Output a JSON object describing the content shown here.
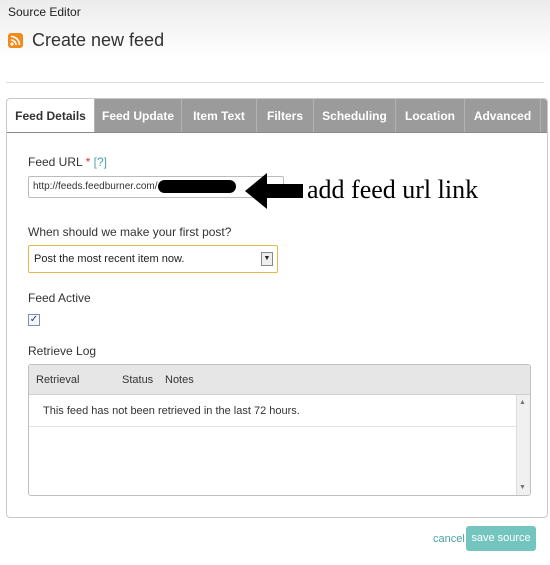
{
  "window_title": "Source Editor",
  "page_title": "Create new feed",
  "icon_rss": "rss-icon",
  "tabs": [
    {
      "label": "Feed Details",
      "active": true
    },
    {
      "label": "Feed Update",
      "active": false
    },
    {
      "label": "Item Text",
      "active": false
    },
    {
      "label": "Filters",
      "active": false
    },
    {
      "label": "Scheduling",
      "active": false
    },
    {
      "label": "Location",
      "active": false
    },
    {
      "label": "Advanced",
      "active": false
    }
  ],
  "feed_url": {
    "label": "Feed URL",
    "required_marker": "*",
    "help": "[?]",
    "value": "http://feeds.feedburner.com/"
  },
  "annotation": {
    "text": "add feed url link"
  },
  "first_post": {
    "label": "When should we make your first post?",
    "selected": "Post the most recent item now."
  },
  "feed_active": {
    "label": "Feed Active",
    "checked": true
  },
  "retrieve_log": {
    "label": "Retrieve Log",
    "columns": [
      "Retrieval",
      "Status",
      "Notes"
    ],
    "empty_message": "This feed has not been retrieved in the last 72 hours."
  },
  "actions": {
    "cancel": "cancel",
    "save": "save source"
  },
  "colors": {
    "accent": "#4aa3a0",
    "save_button": "#74c5c0",
    "tab_bar": "#9b9b9b",
    "rss": "#f28a1c"
  }
}
